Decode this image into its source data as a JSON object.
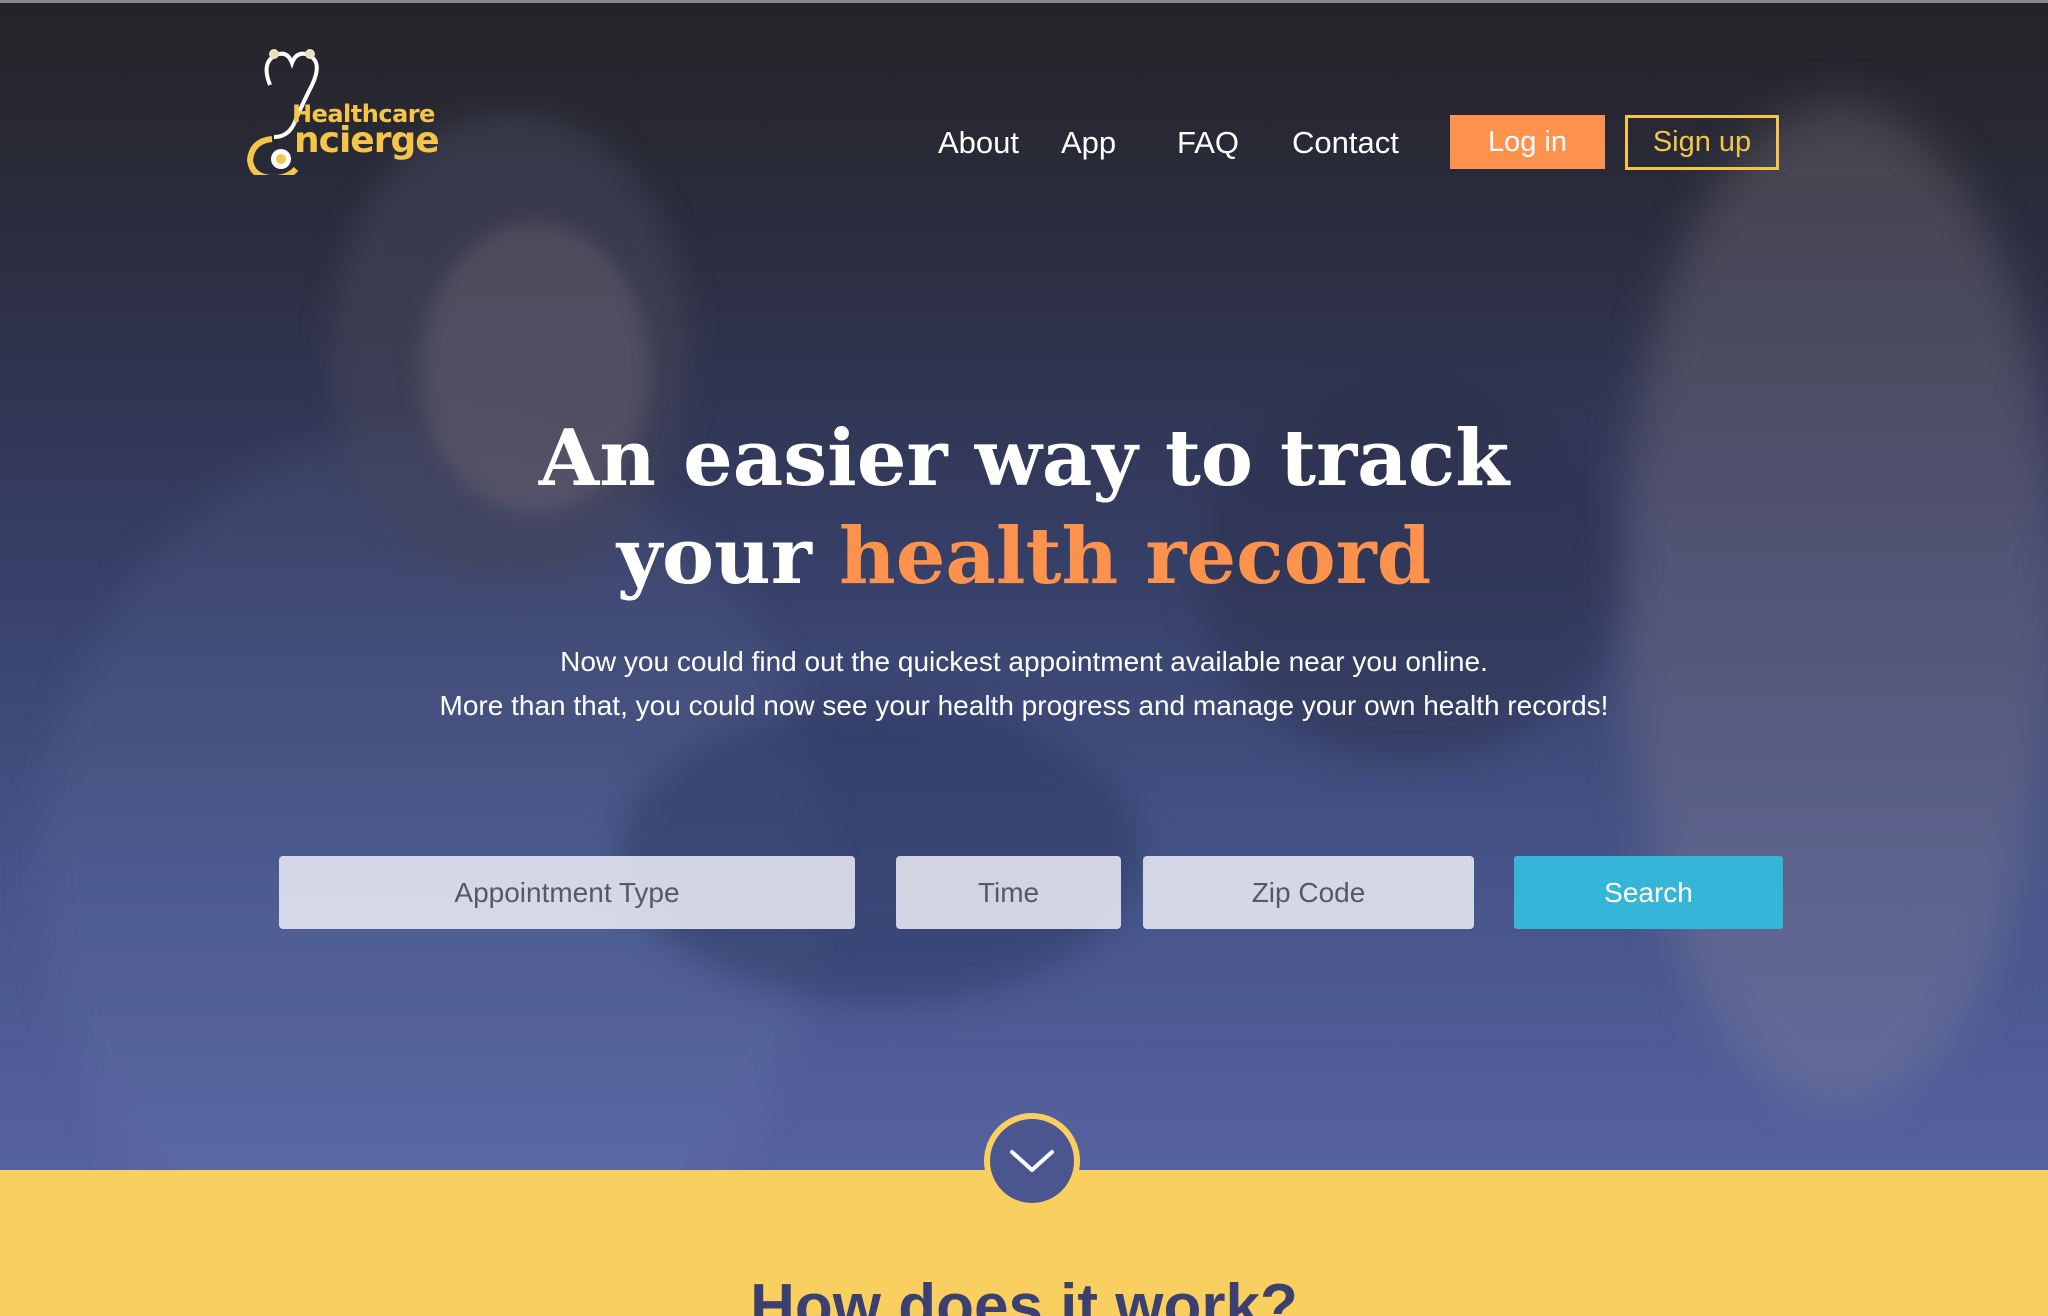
{
  "brand": {
    "name_line1": "Healthcare",
    "name_line2": "ncierge",
    "logo_icon": "stethoscope-icon",
    "color": "#f7c44a"
  },
  "nav": {
    "items": [
      {
        "label": "About"
      },
      {
        "label": "App"
      },
      {
        "label": "FAQ"
      },
      {
        "label": "Contact"
      }
    ],
    "login_label": "Log in",
    "signup_label": "Sign up"
  },
  "hero": {
    "headline_line1": "An easier way to track",
    "headline_line2_prefix": "your ",
    "headline_line2_accent": "health record",
    "subtitle_line1": "Now you could find out the quickest appointment available near you online.",
    "subtitle_line2": "More than that, you could now see your health progress and manage your own health records!"
  },
  "search": {
    "appointment_type_placeholder": "Appointment Type",
    "time_placeholder": "Time",
    "zip_placeholder": "Zip Code",
    "button_label": "Search"
  },
  "scroll": {
    "icon": "chevron-down-icon"
  },
  "section": {
    "title": "How does it work?"
  },
  "colors": {
    "accent_orange": "#fd924d",
    "accent_yellow": "#f9d05f",
    "search_blue": "#35b5d7",
    "hero_navy": "#4b5590"
  }
}
